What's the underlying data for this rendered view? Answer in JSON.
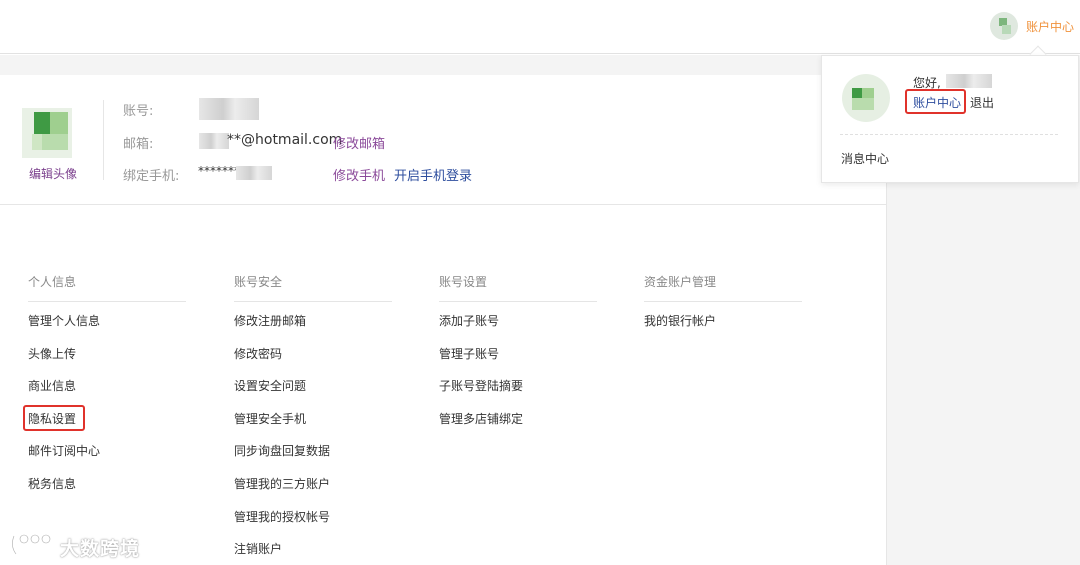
{
  "header": {
    "account_center_label": "账户中心"
  },
  "profile": {
    "edit_avatar_label": "编辑头像",
    "account_label": "账号:",
    "email_label": "邮箱:",
    "email_value": "**@hotmail.com",
    "change_email_label": "修改邮箱",
    "phone_label": "绑定手机:",
    "phone_value": "*******",
    "change_phone_label": "修改手机",
    "enable_phone_login_label": "开启手机登录"
  },
  "columns": [
    {
      "title": "个人信息",
      "items": [
        "管理个人信息",
        "头像上传",
        "商业信息",
        "隐私设置",
        "邮件订阅中心",
        "税务信息"
      ]
    },
    {
      "title": "账号安全",
      "items": [
        "修改注册邮箱",
        "修改密码",
        "设置安全问题",
        "管理安全手机",
        "同步询盘回复数据",
        "管理我的三方账户",
        "管理我的授权帐号",
        "注销账户"
      ]
    },
    {
      "title": "账号设置",
      "items": [
        "添加子账号",
        "管理子账号",
        "子账号登陆摘要",
        "管理多店铺绑定"
      ]
    },
    {
      "title": "资金账户管理",
      "items": [
        "我的银行帐户"
      ]
    }
  ],
  "dropdown": {
    "greeting": "您好,",
    "account_center_label": "账户中心",
    "logout_label": "退出",
    "message_center_label": "消息中心"
  },
  "watermark": {
    "text": "大数跨境"
  },
  "colors": {
    "accent_orange": "#f0923c",
    "link_purple": "#8b4a9a",
    "link_blue": "#2e4e9e",
    "highlight_red": "#e0322b"
  }
}
